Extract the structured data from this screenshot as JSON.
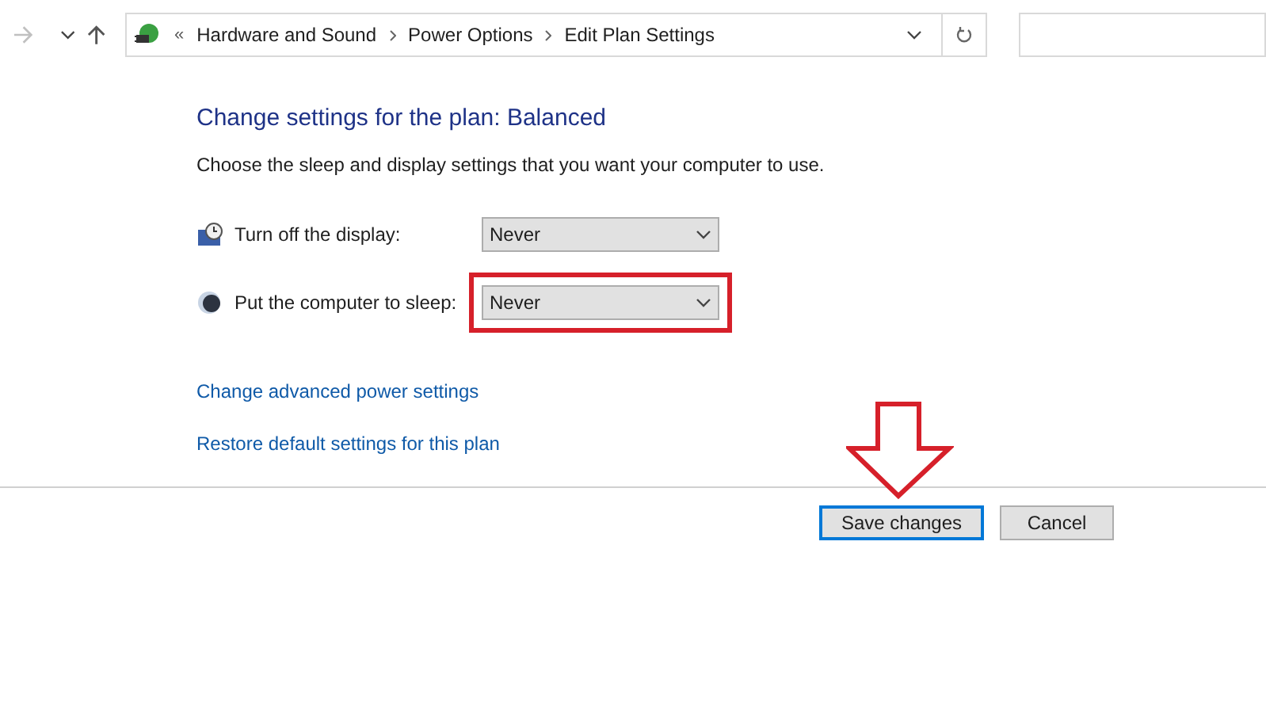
{
  "address_bar": {
    "crumbs": [
      "Hardware and Sound",
      "Power Options",
      "Edit Plan Settings"
    ],
    "overflow": "«"
  },
  "heading": "Change settings for the plan: Balanced",
  "description": "Choose the sleep and display settings that you want your computer to use.",
  "settings": [
    {
      "kind": "display",
      "label": "Turn off the display:",
      "value": "Never",
      "highlighted": false
    },
    {
      "kind": "sleep",
      "label": "Put the computer to sleep:",
      "value": "Never",
      "highlighted": true
    }
  ],
  "links": [
    "Change advanced power settings",
    "Restore default settings for this plan"
  ],
  "buttons": [
    {
      "label": "Save changes",
      "default": true,
      "arrow": true
    },
    {
      "label": "Cancel",
      "default": false,
      "arrow": false
    }
  ]
}
